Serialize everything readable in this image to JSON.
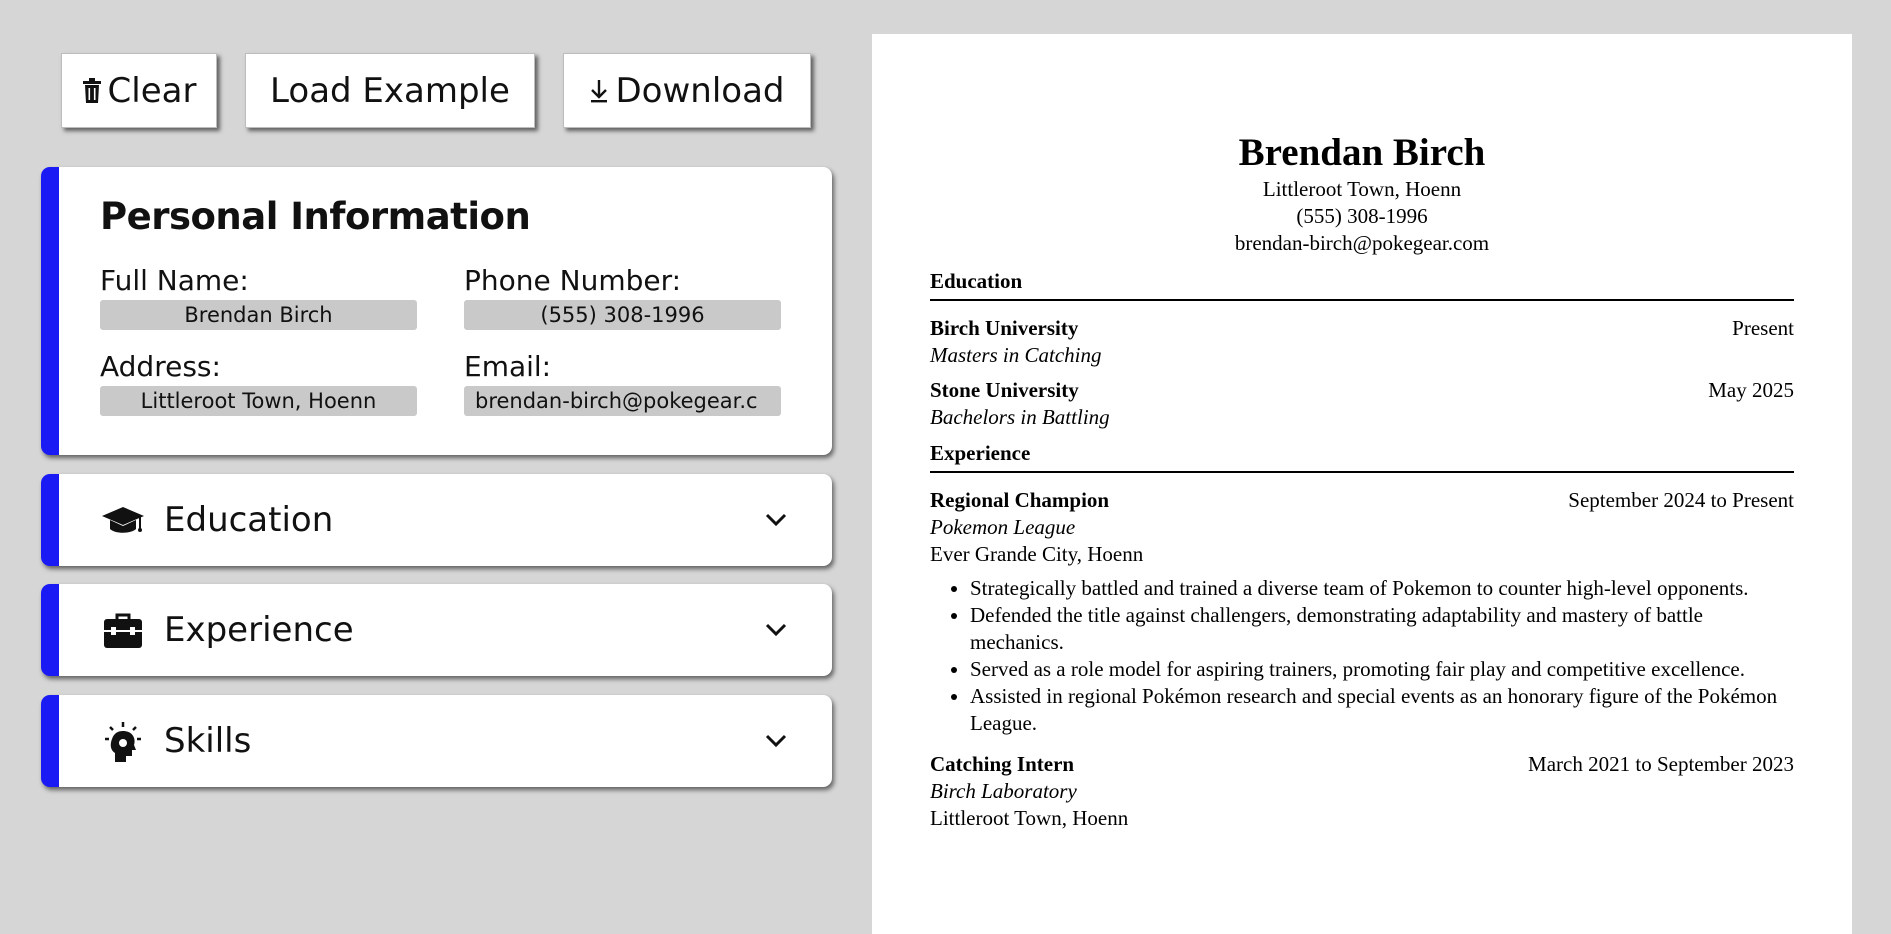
{
  "toolbar": {
    "clear_label": "Clear",
    "load_label": "Load Example",
    "download_label": "Download"
  },
  "personal": {
    "title": "Personal Information",
    "full_name_label": "Full Name:",
    "full_name_value": "Brendan Birch",
    "phone_label": "Phone Number:",
    "phone_value": "(555) 308-1996",
    "address_label": "Address:",
    "address_value": "Littleroot Town, Hoenn",
    "email_label": "Email:",
    "email_value": "brendan-birch@pokegear.c"
  },
  "sections": {
    "education": "Education",
    "experience": "Experience",
    "skills": "Skills"
  },
  "colors": {
    "accent": "#1a1af5",
    "background": "#d6d6d6",
    "input_bg": "#c9c9c9"
  },
  "resume": {
    "name": "Brendan Birch",
    "address": "Littleroot Town, Hoenn",
    "phone": "(555) 308-1996",
    "email": "brendan-birch@pokegear.com",
    "education_heading": "Education",
    "education": [
      {
        "school": "Birch University",
        "date": "Present",
        "degree": "Masters in Catching"
      },
      {
        "school": "Stone University",
        "date": "May 2025",
        "degree": "Bachelors in Battling"
      }
    ],
    "experience_heading": "Experience",
    "experience": [
      {
        "title": "Regional Champion",
        "date": "September 2024 to Present",
        "org": "Pokemon League",
        "location": "Ever Grande City, Hoenn",
        "bullets": [
          "Strategically battled and trained a diverse team of Pokemon to counter high-level opponents.",
          "Defended the title against challengers, demonstrating adaptability and mastery of battle mechanics.",
          "Served as a role model for aspiring trainers, promoting fair play and competitive excellence.",
          "Assisted in regional Pokémon research and special events as an honorary figure of the Pokémon League."
        ]
      },
      {
        "title": "Catching Intern",
        "date": "March 2021 to September 2023",
        "org": "Birch Laboratory",
        "location": "Littleroot Town, Hoenn"
      }
    ]
  }
}
